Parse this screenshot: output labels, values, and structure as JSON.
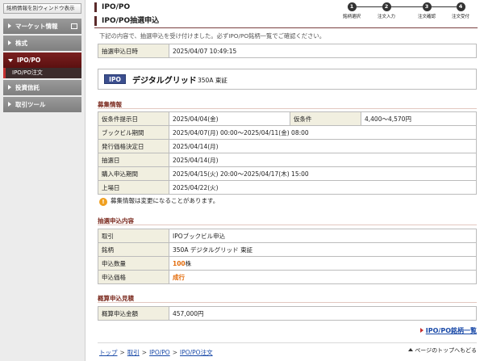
{
  "sidebar": {
    "open_window_btn": "銘柄情報を別ウィンドウ表示",
    "items": [
      {
        "label": "マーケット情報",
        "has_window_icon": true
      },
      {
        "label": "株式"
      },
      {
        "label": "IPO/PO",
        "active": true
      },
      {
        "label": "投資信託"
      },
      {
        "label": "取引ツール"
      }
    ],
    "sub_item": "IPO/PO注文"
  },
  "header": {
    "section": "IPO/PO",
    "title": "IPO/PO抽選申込"
  },
  "steps": [
    {
      "num": "1",
      "label": "銘柄選択"
    },
    {
      "num": "2",
      "label": "注文入力"
    },
    {
      "num": "3",
      "label": "注文確認"
    },
    {
      "num": "4",
      "label": "注文受付"
    }
  ],
  "message": "下記の内容で、抽選申込を受け付けました。必ずIPO/PO銘柄一覧でご確認ください。",
  "timestamp": {
    "label": "抽選申込日時",
    "value": "2025/04/07 10:49:15"
  },
  "stock": {
    "badge": "IPO",
    "name": "デジタルグリッド",
    "code_market": "350A 東証"
  },
  "recruit": {
    "heading": "募集情報",
    "rows": [
      {
        "label": "仮条件提示日",
        "value": "2025/04/04(金)",
        "label2": "仮条件",
        "value2": "4,400～4,570円"
      },
      {
        "label": "ブックビル期間",
        "value": "2025/04/07(月) 00:00～2025/04/11(金) 08:00"
      },
      {
        "label": "発行価格決定日",
        "value": "2025/04/14(月)"
      },
      {
        "label": "抽選日",
        "value": "2025/04/14(月)"
      },
      {
        "label": "購入申込期間",
        "value": "2025/04/15(火) 20:00～2025/04/17(木) 15:00"
      },
      {
        "label": "上場日",
        "value": "2025/04/22(火)"
      }
    ],
    "note": "募集情報は変更になることがあります。"
  },
  "order": {
    "heading": "抽選申込内容",
    "rows": [
      {
        "label": "取引",
        "value": "IPOブックビル申込"
      },
      {
        "label": "銘柄",
        "value": "350A デジタルグリッド 東証"
      },
      {
        "label": "申込数量",
        "value_num": "100",
        "value_unit": "株"
      },
      {
        "label": "申込価格",
        "value": "成行"
      }
    ]
  },
  "estimate": {
    "heading": "概算申込見積",
    "label": "概算申込金額",
    "value": "457,000円"
  },
  "list_link": "IPO/PO銘柄一覧",
  "breadcrumb": [
    "トップ",
    "取引",
    "IPO/PO",
    "IPO/PO注文"
  ],
  "page_top": "ページのトップへもどる",
  "colors": {
    "accent": "#7b2a1e",
    "link": "#1a4aa8",
    "orange": "#e26b0a",
    "ipo_badge": "#3c4f8f"
  }
}
